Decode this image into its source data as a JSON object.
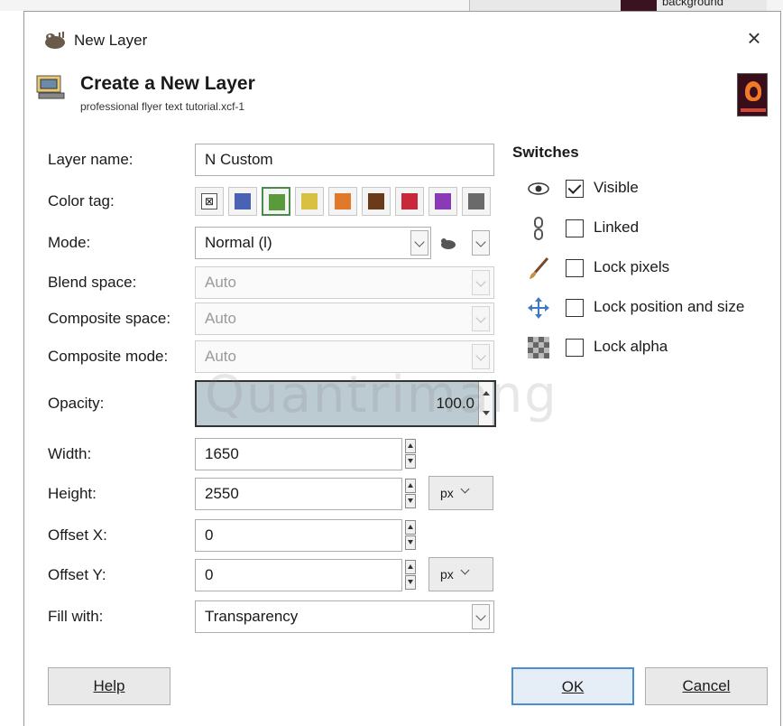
{
  "background_app": {
    "layer_label": "background"
  },
  "dialog": {
    "window_title": "New Layer",
    "close_glyph": "×",
    "header_title": "Create a New Layer",
    "header_subtitle": "professional flyer text tutorial.xcf-1"
  },
  "form": {
    "layer_name": {
      "label": "Layer name:",
      "value": "N Custom"
    },
    "color_tag": {
      "label": "Color tag:",
      "tags": [
        {
          "name": "none",
          "color": "#ffffff",
          "glyph": "⊠"
        },
        {
          "name": "blue",
          "color": "#4a62b4"
        },
        {
          "name": "green",
          "color": "#5a9a3a",
          "selected": true
        },
        {
          "name": "yellow",
          "color": "#d8c040"
        },
        {
          "name": "orange",
          "color": "#e07a2a"
        },
        {
          "name": "brown",
          "color": "#6a3a1a"
        },
        {
          "name": "red",
          "color": "#c8283a"
        },
        {
          "name": "violet",
          "color": "#8a3ab4"
        },
        {
          "name": "gray",
          "color": "#6a6a6a"
        }
      ]
    },
    "mode": {
      "label": "Mode:",
      "value": "Normal (l)"
    },
    "blend_space": {
      "label": "Blend space:",
      "value": "Auto"
    },
    "composite_space": {
      "label": "Composite space:",
      "value": "Auto"
    },
    "composite_mode": {
      "label": "Composite mode:",
      "value": "Auto"
    },
    "opacity": {
      "label": "Opacity:",
      "value": "100.0",
      "level": 1.0
    },
    "width": {
      "label": "Width:",
      "value": "1650"
    },
    "height": {
      "label": "Height:",
      "value": "2550",
      "unit": "px"
    },
    "offset_x": {
      "label": "Offset X:",
      "value": "0"
    },
    "offset_y": {
      "label": "Offset Y:",
      "value": "0",
      "unit": "px"
    },
    "fill_with": {
      "label": "Fill with:",
      "value": "Transparency"
    }
  },
  "switches": {
    "title": "Switches",
    "items": [
      {
        "label": "Visible",
        "checked": true,
        "icon": "eye-icon"
      },
      {
        "label": "Linked",
        "checked": false,
        "icon": "chain-icon"
      },
      {
        "label": "Lock pixels",
        "checked": false,
        "icon": "brush-icon"
      },
      {
        "label": "Lock position and size",
        "checked": false,
        "icon": "move-icon"
      },
      {
        "label": "Lock alpha",
        "checked": false,
        "icon": "checkerboard-icon"
      }
    ]
  },
  "buttons": {
    "help": "Help",
    "ok": "OK",
    "cancel": "Cancel"
  },
  "watermark": "Quantrimang",
  "colors": {
    "accent": "#4a8ed0",
    "opacity_fill": "#bccbd2"
  }
}
